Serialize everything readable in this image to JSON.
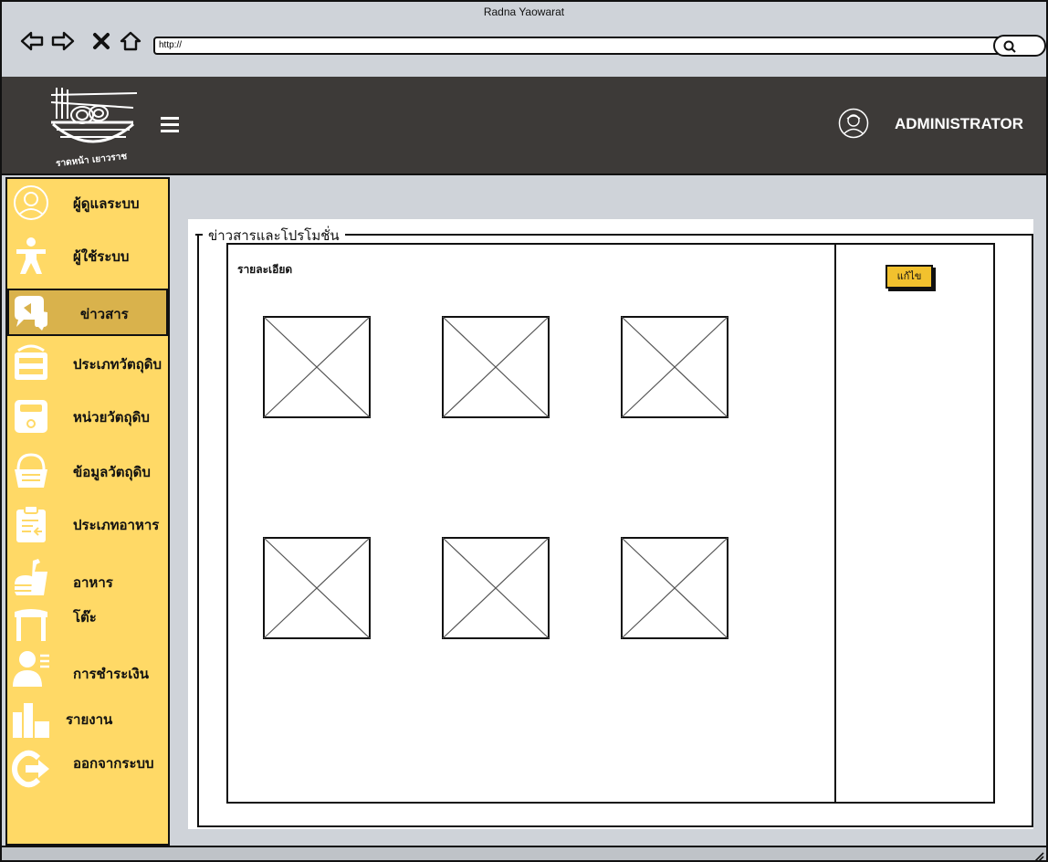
{
  "window": {
    "title": "Radna Yaowarat"
  },
  "browser": {
    "address": "http://",
    "icons": [
      "back-arrow-icon",
      "forward-arrow-icon",
      "close-x-icon",
      "home-icon",
      "search-icon"
    ]
  },
  "header": {
    "logo_text": "ราดหน้า เยาวราช",
    "user_label": "ADMINISTRATOR"
  },
  "sidebar": {
    "items": [
      {
        "label": "ผู้ดูแลระบบ",
        "icon": "user-circle-icon"
      },
      {
        "label": "ผู้ใช้ระบบ",
        "icon": "person-icon"
      },
      {
        "label": "ข่าวสาร",
        "icon": "megaphone-icon",
        "active": true
      },
      {
        "label": "ประเภทวัตถุดิบ",
        "icon": "cabinet-icon"
      },
      {
        "label": "หน่วยวัตถุดิบ",
        "icon": "scale-icon"
      },
      {
        "label": "ข้อมูลวัตถุดิบ",
        "icon": "basket-icon"
      },
      {
        "label": "ประเภทอาหาร",
        "icon": "clipboard-icon"
      },
      {
        "label": "อาหาร",
        "icon": "food-icon"
      },
      {
        "label": "โต๊ะ",
        "icon": "table-icon"
      },
      {
        "label": "การชำระเงิน",
        "icon": "payment-icon"
      },
      {
        "label": "รายงาน",
        "icon": "bar-chart-icon"
      },
      {
        "label": "ออกจากระบบ",
        "icon": "logout-icon"
      }
    ]
  },
  "main": {
    "section_title": "ข่าวสารและโปรโมชั่น",
    "detail_label": "รายละเอียด",
    "edit_button": "แก้ไข",
    "image_placeholders": 6
  },
  "colors": {
    "sidebar_bg": "#ffd966",
    "sidebar_active": "#d9b24c",
    "header_bg": "#3d3a38",
    "edit_button_bg": "#f2c12e"
  }
}
